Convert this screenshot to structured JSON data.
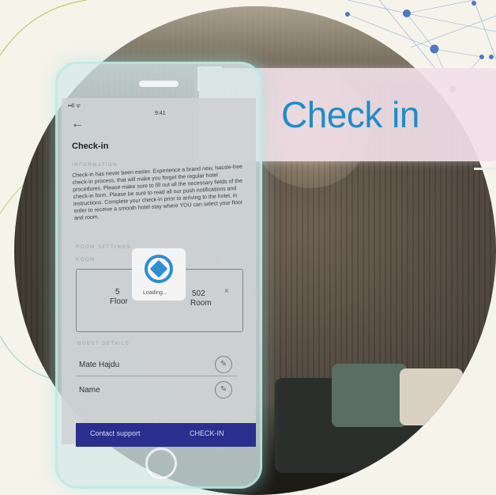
{
  "banner": {
    "text": "Check in"
  },
  "status": {
    "signal": "••ll ᯤ",
    "time": "9:41"
  },
  "screen": {
    "back_icon": "arrow-left-icon",
    "title": "Check-in",
    "section_info": "INFORMATION",
    "description": "Check-in has never been easier. Experience a brand new, hassle-free check-in process, that will make you forget the regular hotel procedures. Please make sure to fill out all the necessary fields of the check-in form. Please be sure to read all our push notifications and instructions. Complete your check-in prior to arriving to the hotel, in order to receive a smooth hotel stay where YOU can select your floor and room.",
    "section_room": "ROOM SETTINGS",
    "section_room2": "ROOM",
    "floor_number": "5",
    "floor_label": "Floor",
    "room_number": "502",
    "room_label": "Room",
    "loading_text": "Loading...",
    "section_guests": "GUEST DETAILS",
    "guest_1": "Mate Hajdu",
    "guest_2": "Name",
    "contact_button": "Contact support",
    "checkin_button": "CHECK-IN"
  },
  "colors": {
    "accent": "#2d8fcf",
    "bar": "#2a2f8d",
    "background": "#f6f3ea"
  }
}
